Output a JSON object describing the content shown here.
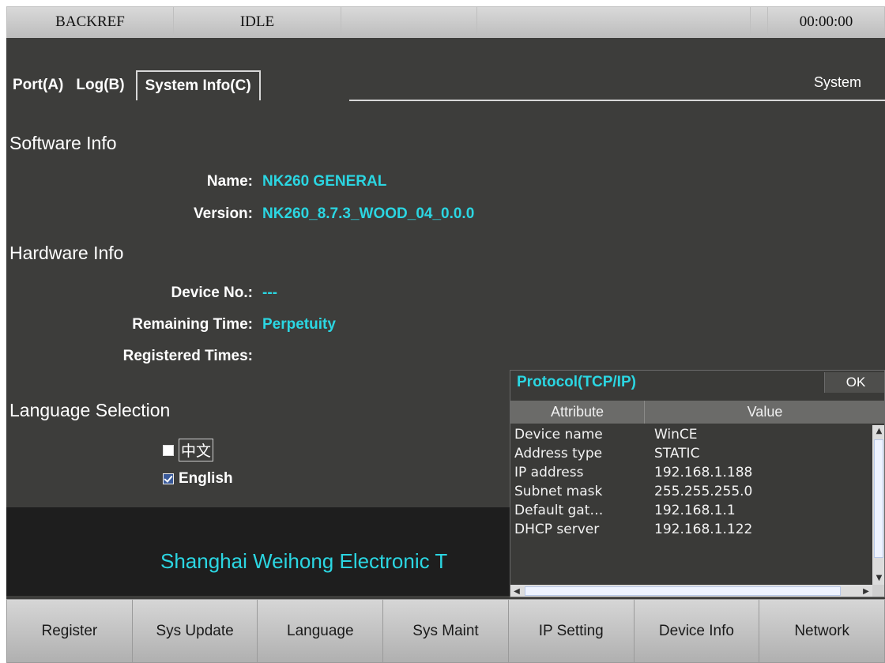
{
  "status_bar": {
    "cells": [
      "BACKREF",
      "IDLE",
      "",
      "",
      "",
      "00:00:00"
    ]
  },
  "tabs": [
    {
      "label": "Port(A)"
    },
    {
      "label": "Log(B)"
    },
    {
      "label": "System Info(C)",
      "active": true
    }
  ],
  "mode_label": "System",
  "software_info": {
    "title": "Software Info",
    "name_label": "Name:",
    "name_value": "NK260 GENERAL",
    "version_label": "Version:",
    "version_value": "NK260_8.7.3_WOOD_04_0.0.0"
  },
  "hardware_info": {
    "title": "Hardware Info",
    "device_label": "Device No.:",
    "device_value": "---",
    "remaining_label": "Remaining Time:",
    "remaining_value": "Perpetuity",
    "registered_label": "Registered Times:",
    "registered_value": ""
  },
  "language": {
    "title": "Language Selection",
    "options": [
      {
        "label": "中文",
        "checked": false
      },
      {
        "label": "English",
        "checked": true
      }
    ]
  },
  "company_text": "Shanghai Weihong Electronic T",
  "protocol_popup": {
    "title": "Protocol(TCP/IP)",
    "ok_label": "OK",
    "col_attribute": "Attribute",
    "col_value": "Value",
    "rows": [
      {
        "attr": "Device name",
        "value": "WinCE"
      },
      {
        "attr": "Address type",
        "value": "STATIC"
      },
      {
        "attr": "IP address",
        "value": "192.168.1.188"
      },
      {
        "attr": "Subnet mask",
        "value": "255.255.255.0"
      },
      {
        "attr": "Default gat…",
        "value": "192.168.1.1"
      },
      {
        "attr": "DHCP server",
        "value": "192.168.1.122"
      }
    ]
  },
  "toolbar": {
    "buttons": [
      "Register",
      "Sys Update",
      "Language",
      "Sys Maint",
      "IP Setting",
      "Device Info",
      "Network"
    ]
  },
  "colors": {
    "background": "#3d3d3b",
    "accent_cyan": "#2bd6e2",
    "banner": "#1e1e1e"
  }
}
